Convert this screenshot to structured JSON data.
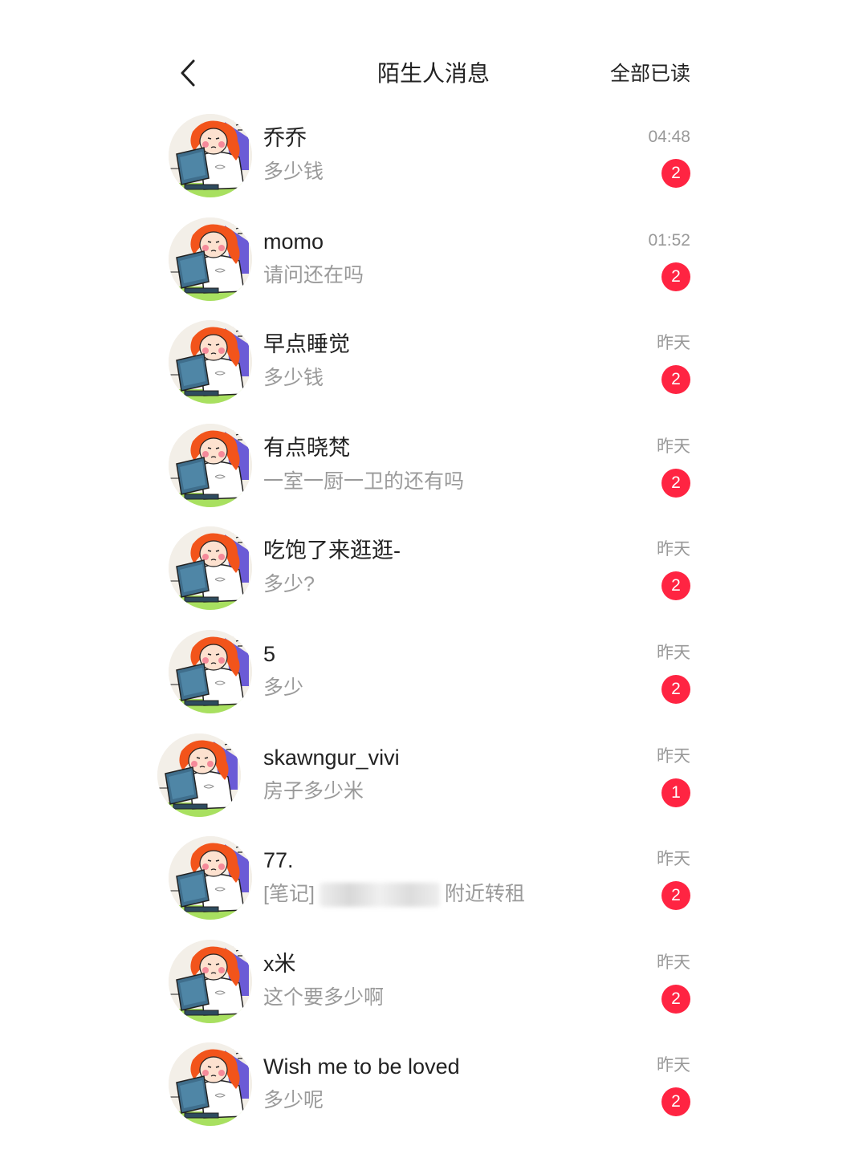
{
  "header": {
    "title": "陌生人消息",
    "mark_all_read": "全部已读"
  },
  "messages": [
    {
      "name": "乔乔",
      "preview": "多少钱",
      "time": "04:48",
      "unread": "2"
    },
    {
      "name": "momo",
      "preview": "请问还在吗",
      "time": "01:52",
      "unread": "2"
    },
    {
      "name": "早点睡觉",
      "preview": "多少钱",
      "time": "昨天",
      "unread": "2"
    },
    {
      "name": "有点晓梵",
      "preview": "一室一厨一卫的还有吗",
      "time": "昨天",
      "unread": "2"
    },
    {
      "name": "吃饱了来逛逛-",
      "preview": "多少?",
      "time": "昨天",
      "unread": "2"
    },
    {
      "name": "5",
      "preview": "多少",
      "time": "昨天",
      "unread": "2"
    },
    {
      "name": "skawngur_vivi",
      "preview": "房子多少米",
      "time": "昨天",
      "unread": "1"
    },
    {
      "name": "77.",
      "preview_prefix": "[笔记]",
      "preview_suffix": "附近转租",
      "time": "昨天",
      "unread": "2"
    },
    {
      "name": "x米",
      "preview": "这个要多少啊",
      "time": "昨天",
      "unread": "2"
    },
    {
      "name": "Wish me to be loved",
      "preview": "多少呢",
      "time": "昨天",
      "unread": "2"
    }
  ],
  "colors": {
    "badge": "#ff2442",
    "preview_text": "#9a9a9a",
    "time_text": "#999999"
  },
  "icons": {
    "back": "chevron-left-icon",
    "avatar": "cartoon-girl-at-computer"
  }
}
